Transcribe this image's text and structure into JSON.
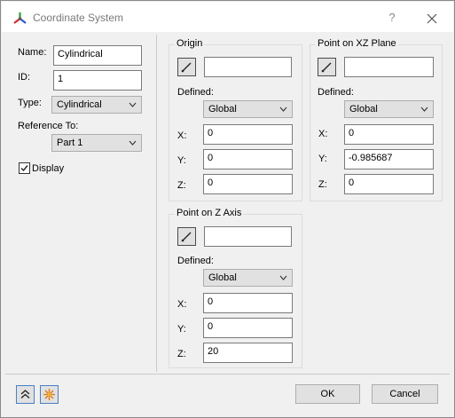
{
  "window": {
    "title": "Coordinate System",
    "help": "?"
  },
  "left": {
    "name_label": "Name:",
    "name_value": "Cylindrical",
    "id_label": "ID:",
    "id_value": "1",
    "type_label": "Type:",
    "type_value": "Cylindrical",
    "reference_label": "Reference To:",
    "reference_value": "Part 1",
    "display_label": "Display",
    "display_checked": true
  },
  "origin": {
    "title": "Origin",
    "pick_value": "",
    "defined_label": "Defined:",
    "defined_value": "Global",
    "x_label": "X:",
    "x": "0",
    "y_label": "Y:",
    "y": "0",
    "z_label": "Z:",
    "z": "0"
  },
  "xz_plane": {
    "title": "Point on XZ Plane",
    "pick_value": "",
    "defined_label": "Defined:",
    "defined_value": "Global",
    "x_label": "X:",
    "x": "0",
    "y_label": "Y:",
    "y": "-0.985687",
    "z_label": "Z:",
    "z": "0"
  },
  "z_axis": {
    "title": "Point on Z Axis",
    "pick_value": "",
    "defined_label": "Defined:",
    "defined_value": "Global",
    "x_label": "X:",
    "x": "0",
    "y_label": "Y:",
    "y": "0",
    "z_label": "Z:",
    "z": "20"
  },
  "footer": {
    "ok_label": "OK",
    "cancel_label": "Cancel"
  },
  "icons": {
    "title": "coordinate-axes-icon",
    "help": "help-icon",
    "close": "close-icon",
    "pick": "pick-point-icon",
    "dropdown": "chevron-down-icon",
    "collapse": "double-chevron-up-icon",
    "options": "starburst-icon"
  },
  "colors": {
    "accent_border": "#4a7ec8",
    "button_face": "#e1e1e1",
    "window_bg": "#f0f0f0"
  }
}
